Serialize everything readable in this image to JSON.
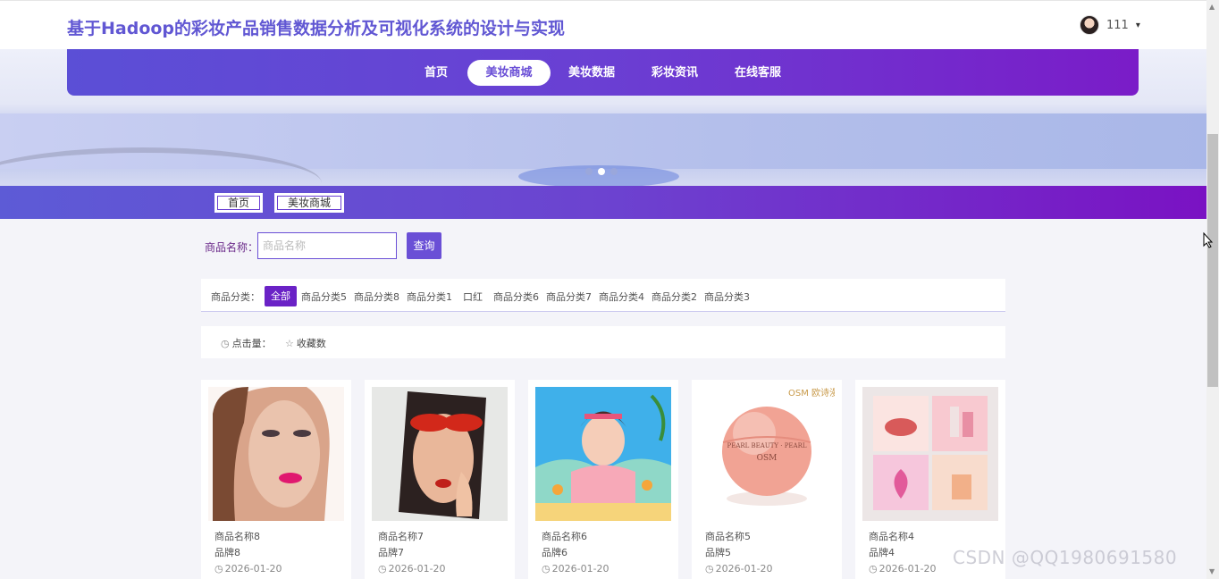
{
  "header": {
    "title": "基于Hadoop的彩妆产品销售数据分析及可视化系统的设计与实现",
    "user_name": "111",
    "caret": "▾"
  },
  "nav": {
    "items": [
      {
        "label": "首页",
        "active": false
      },
      {
        "label": "美妆商城",
        "active": true
      },
      {
        "label": "美妆数据",
        "active": false
      },
      {
        "label": "彩妆资讯",
        "active": false
      },
      {
        "label": "在线客服",
        "active": false
      }
    ]
  },
  "carousel": {
    "slides": 3,
    "active_index": 1
  },
  "breadcrumb": [
    "首页",
    "美妆商城"
  ],
  "search": {
    "label": "商品名称：",
    "placeholder": "商品名称",
    "value": "",
    "button": "查询"
  },
  "categories": {
    "label": "商品分类：",
    "items": [
      "全部",
      "商品分类5",
      "商品分类8",
      "商品分类1",
      "口红",
      "商品分类6",
      "商品分类7",
      "商品分类4",
      "商品分类2",
      "商品分类3"
    ],
    "active": "全部"
  },
  "sort": {
    "items": [
      {
        "label": "点击量：",
        "icon": "clock-icon"
      },
      {
        "label": "收藏数",
        "icon": "star-icon"
      }
    ]
  },
  "products": [
    {
      "name": "商品名称8",
      "brand": "品牌8",
      "date": "2026-01-20"
    },
    {
      "name": "商品名称7",
      "brand": "品牌7",
      "date": "2026-01-20"
    },
    {
      "name": "商品名称6",
      "brand": "品牌6",
      "date": "2026-01-20"
    },
    {
      "name": "商品名称5",
      "brand": "品牌5",
      "date": "2026-01-20"
    },
    {
      "name": "商品名称4",
      "brand": "品牌4",
      "date": "2026-01-20"
    }
  ],
  "product_image_text": {
    "osm_logo": "OSM 欧诗漫",
    "jar_text": "PEARL BEAUTY · PEARL",
    "jar_brand": "OSM"
  },
  "watermark": "CSDN @QQ1980691580"
}
